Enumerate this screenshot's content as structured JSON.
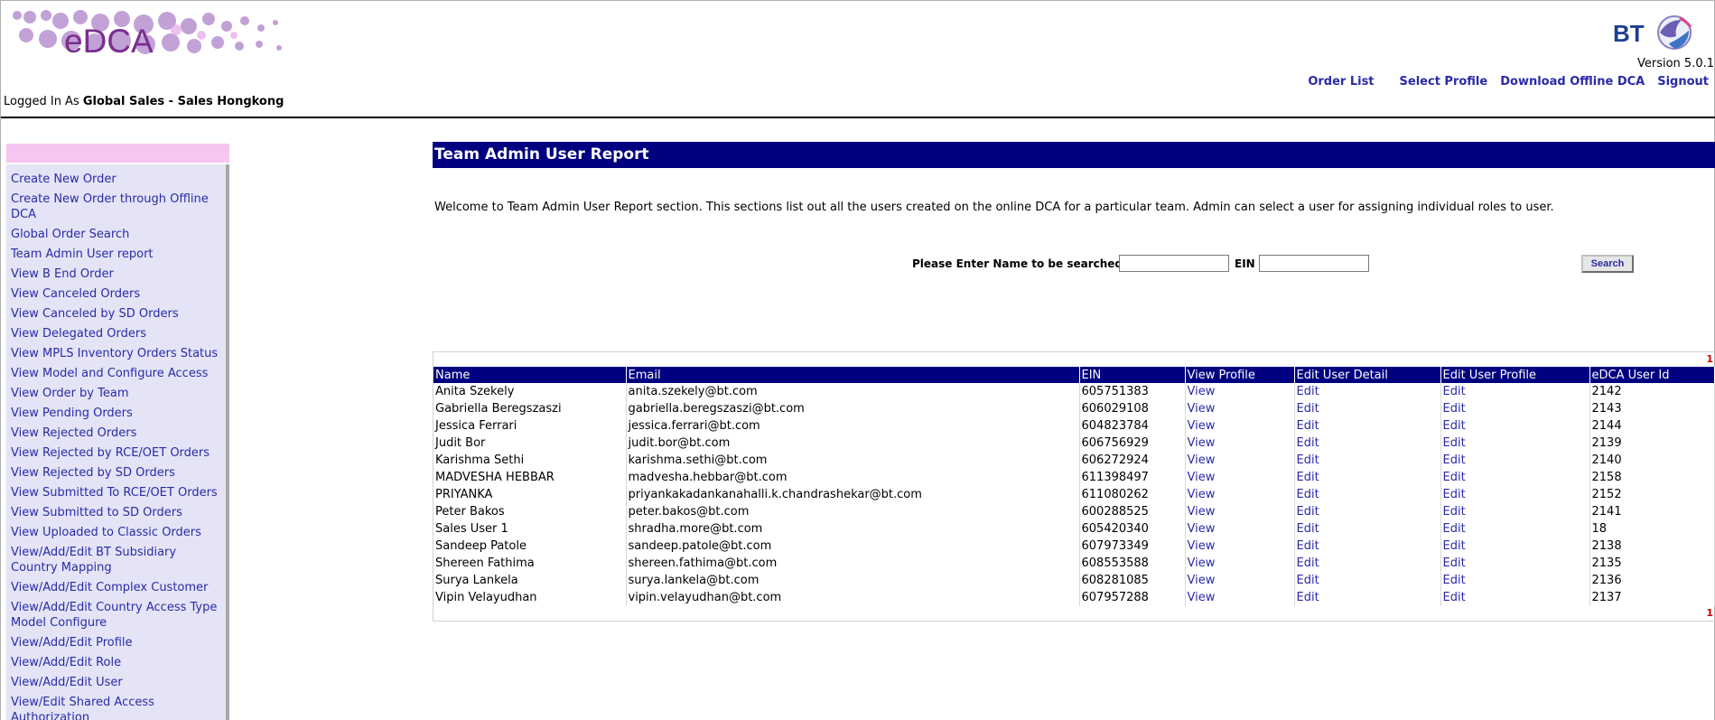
{
  "app": {
    "logo_text": "eDCA",
    "version": "Version 5.0.1",
    "colors": {
      "title_bar": "#000080",
      "link": "#2a2aa8",
      "sidebar_bg": "#e4e4f6",
      "sidebar_header": "#f8c4f0",
      "logo_purple": "#7a2f8e",
      "bt_blue": "#1e3f8f"
    }
  },
  "bt_logo": {
    "text": "BT",
    "icon": "bt-globe-icon"
  },
  "top_nav": {
    "order_list": "Order List",
    "select_profile": "Select Profile",
    "download_offline": "Download Offline DCA",
    "signout": "Signout"
  },
  "session": {
    "prefix": "Logged In As",
    "user": "Global Sales - Sales Hongkong"
  },
  "sidebar": {
    "items": [
      "Create New Order",
      "Create New Order through Offline DCA",
      "Global Order Search",
      "Team Admin User report",
      "View B End Order",
      "View Canceled Orders",
      "View Canceled by SD Orders",
      "View Delegated Orders",
      "View MPLS Inventory Orders Status",
      "View Model and Configure Access",
      "View Order by Team",
      "View Pending Orders",
      "View Rejected Orders",
      "View Rejected by RCE/OET Orders",
      "View Rejected by SD Orders",
      "View Submitted To RCE/OET Orders",
      "View Submitted to SD Orders",
      "View Uploaded to Classic Orders",
      "View/Add/Edit BT Subsidiary Country Mapping",
      "View/Add/Edit Complex Customer",
      "View/Add/Edit Country Access Type Model Configure",
      "View/Add/Edit Profile",
      "View/Add/Edit Role",
      "View/Add/Edit User",
      "View/Edit Shared Access Authorization"
    ]
  },
  "main": {
    "title": "Team Admin User Report",
    "intro": "Welcome to Team Admin User Report section. This sections list out all the users created on the online DCA for a particular team. Admin can select a user for assigning individual roles to user.",
    "search": {
      "name_label": "Please Enter Name to be searched",
      "name_value": "",
      "ein_label": "EIN",
      "ein_value": "",
      "button": "Search"
    },
    "pager_top": "1",
    "pager_bottom": "1",
    "columns": [
      "Name",
      "Email",
      "EIN",
      "View Profile",
      "Edit User Detail",
      "Edit User Profile",
      "eDCA User Id"
    ],
    "rows": [
      {
        "name": "Anita Szekely",
        "email": "anita.szekely@bt.com",
        "ein": "605751383",
        "view": "View",
        "edit_detail": "Edit",
        "edit_profile": "Edit",
        "user_id": "2142"
      },
      {
        "name": "Gabriella Beregszaszi",
        "email": "gabriella.beregszaszi@bt.com",
        "ein": "606029108",
        "view": "View",
        "edit_detail": "Edit",
        "edit_profile": "Edit",
        "user_id": "2143"
      },
      {
        "name": "Jessica Ferrari",
        "email": "jessica.ferrari@bt.com",
        "ein": "604823784",
        "view": "View",
        "edit_detail": "Edit",
        "edit_profile": "Edit",
        "user_id": "2144"
      },
      {
        "name": "Judit Bor",
        "email": "judit.bor@bt.com",
        "ein": "606756929",
        "view": "View",
        "edit_detail": "Edit",
        "edit_profile": "Edit",
        "user_id": "2139"
      },
      {
        "name": "Karishma Sethi",
        "email": "karishma.sethi@bt.com",
        "ein": "606272924",
        "view": "View",
        "edit_detail": "Edit",
        "edit_profile": "Edit",
        "user_id": "2140"
      },
      {
        "name": "MADVESHA HEBBAR",
        "email": "madvesha.hebbar@bt.com",
        "ein": "611398497",
        "view": "View",
        "edit_detail": "Edit",
        "edit_profile": "Edit",
        "user_id": "2158"
      },
      {
        "name": "PRIYANKA",
        "email": "priyankakadankanahalli.k.chandrashekar@bt.com",
        "ein": "611080262",
        "view": "View",
        "edit_detail": "Edit",
        "edit_profile": "Edit",
        "user_id": "2152"
      },
      {
        "name": "Peter Bakos",
        "email": "peter.bakos@bt.com",
        "ein": "600288525",
        "view": "View",
        "edit_detail": "Edit",
        "edit_profile": "Edit",
        "user_id": "2141"
      },
      {
        "name": "Sales User 1",
        "email": "shradha.more@bt.com",
        "ein": "605420340",
        "view": "View",
        "edit_detail": "Edit",
        "edit_profile": "Edit",
        "user_id": "18"
      },
      {
        "name": "Sandeep Patole",
        "email": "sandeep.patole@bt.com",
        "ein": "607973349",
        "view": "View",
        "edit_detail": "Edit",
        "edit_profile": "Edit",
        "user_id": "2138"
      },
      {
        "name": "Shereen Fathima",
        "email": "shereen.fathima@bt.com",
        "ein": "608553588",
        "view": "View",
        "edit_detail": "Edit",
        "edit_profile": "Edit",
        "user_id": "2135"
      },
      {
        "name": "Surya Lankela",
        "email": "surya.lankela@bt.com",
        "ein": "608281085",
        "view": "View",
        "edit_detail": "Edit",
        "edit_profile": "Edit",
        "user_id": "2136"
      },
      {
        "name": "Vipin Velayudhan",
        "email": "vipin.velayudhan@bt.com",
        "ein": "607957288",
        "view": "View",
        "edit_detail": "Edit",
        "edit_profile": "Edit",
        "user_id": "2137"
      }
    ]
  }
}
